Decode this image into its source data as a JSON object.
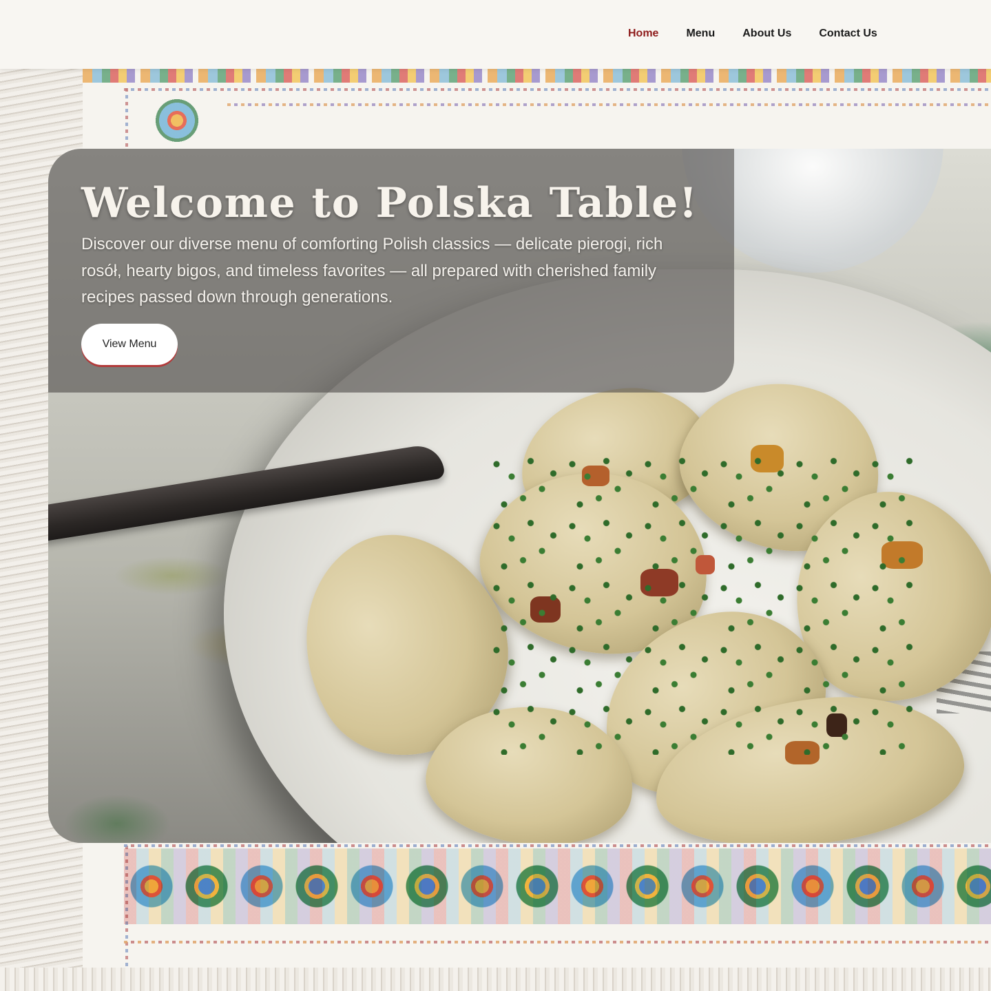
{
  "nav": {
    "links": [
      {
        "label": "Home",
        "active": true
      },
      {
        "label": "Menu",
        "active": false
      },
      {
        "label": "About Us",
        "active": false
      },
      {
        "label": "Contact Us",
        "active": false
      }
    ]
  },
  "hero": {
    "title": "Welcome to Polska Table!",
    "text": "Discover our diverse menu of comforting Polish classics — delicate pierogi, rich rosół, hearty bigos, and timeless favorites — all prepared with cherished family recipes passed down through generations.",
    "cta_label": "View Menu"
  },
  "colors": {
    "nav_background": "#f8f6f2",
    "nav_active": "#8e1b1b",
    "card_overlay": "rgba(80,78,76,0.62)",
    "cta_accent": "#b23a3a"
  }
}
